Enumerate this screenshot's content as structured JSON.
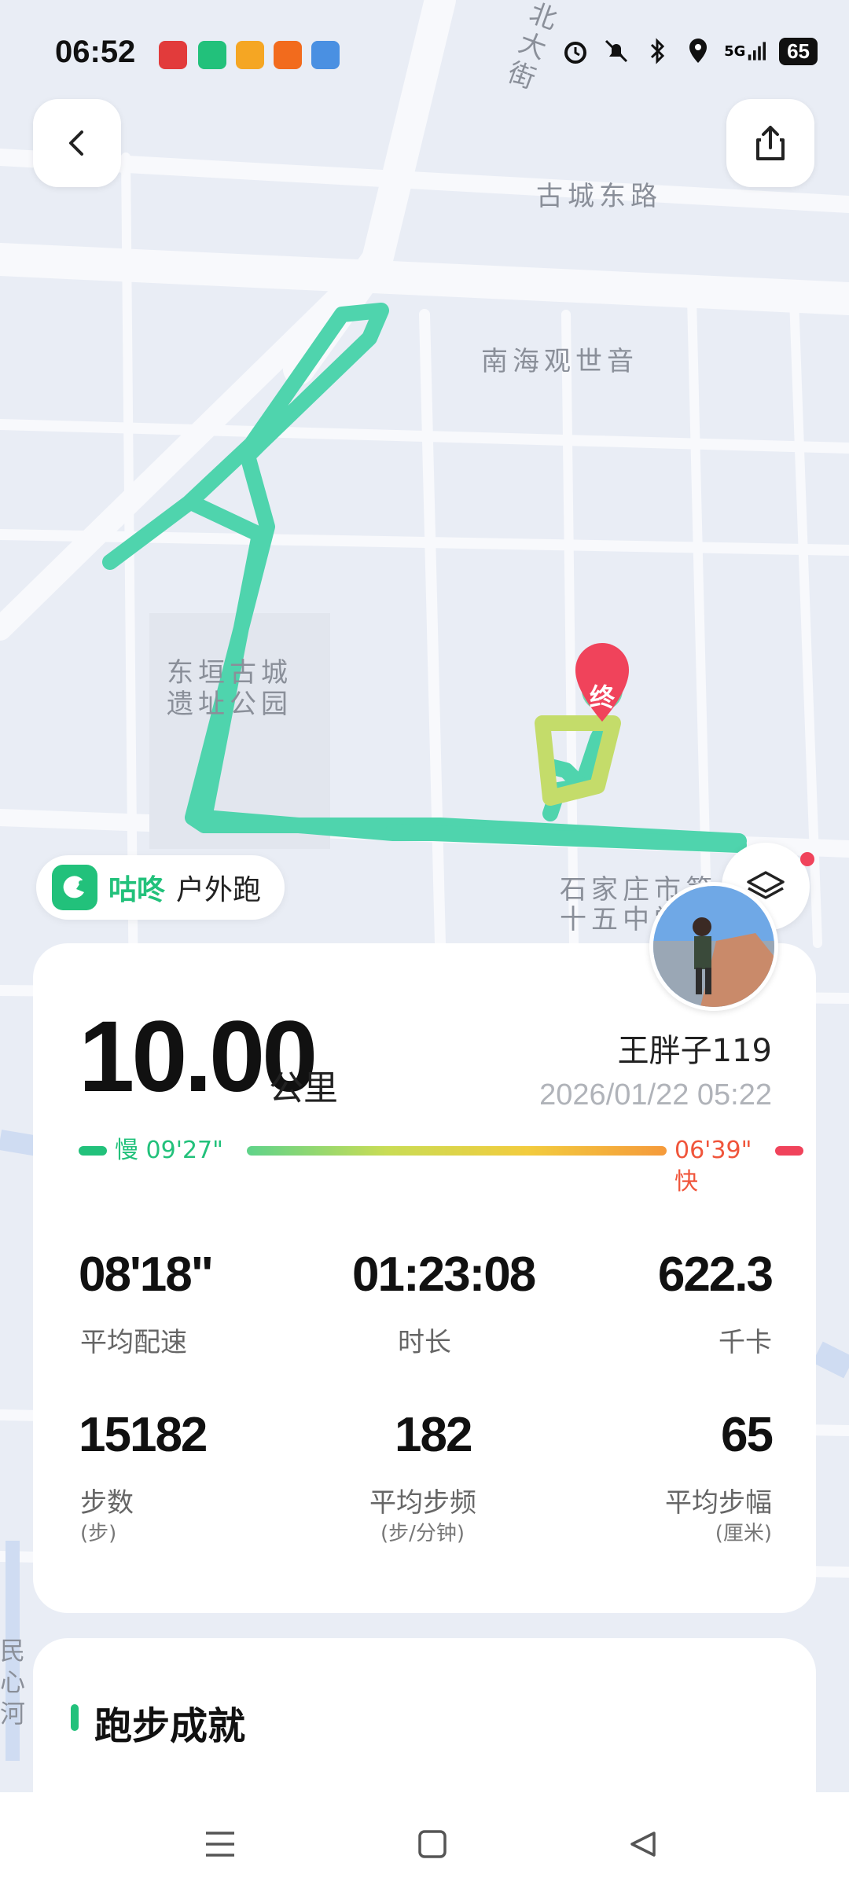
{
  "status_bar": {
    "time": "06:52",
    "network": "5G",
    "battery": "65",
    "notif_colors": [
      "#e23b3b",
      "#22c17b",
      "#f5a623",
      "#f26b1d",
      "#4a90e2"
    ]
  },
  "map": {
    "labels": [
      "北大街",
      "古城东路",
      "南海观世音",
      "东垣古城",
      "遗址公园",
      "石家庄市第",
      "十五中学",
      "民心河"
    ],
    "end_marker": "终"
  },
  "brand": {
    "name": "咕咚",
    "run_type": "户外跑",
    "color": "#22c17b"
  },
  "summary": {
    "distance": "10.00",
    "unit": "公里",
    "username": "王胖子119",
    "datetime": "2026/01/22 05:22",
    "pace_slow_label": "慢 09'27\"",
    "pace_fast_label": "06'39\" 快"
  },
  "stats": [
    {
      "value": "08'18\"",
      "label": "平均配速",
      "sub": ""
    },
    {
      "value": "01:23:08",
      "label": "时长",
      "sub": ""
    },
    {
      "value": "622.3",
      "label": "千卡",
      "sub": ""
    },
    {
      "value": "15182",
      "label": "步数",
      "sub": "(步)"
    },
    {
      "value": "182",
      "label": "平均步频",
      "sub": "(步/分钟)"
    },
    {
      "value": "65",
      "label": "平均步幅",
      "sub": "(厘米)"
    }
  ],
  "achievements": {
    "title": "跑步成就"
  },
  "nav": [
    "menu",
    "home",
    "back"
  ]
}
